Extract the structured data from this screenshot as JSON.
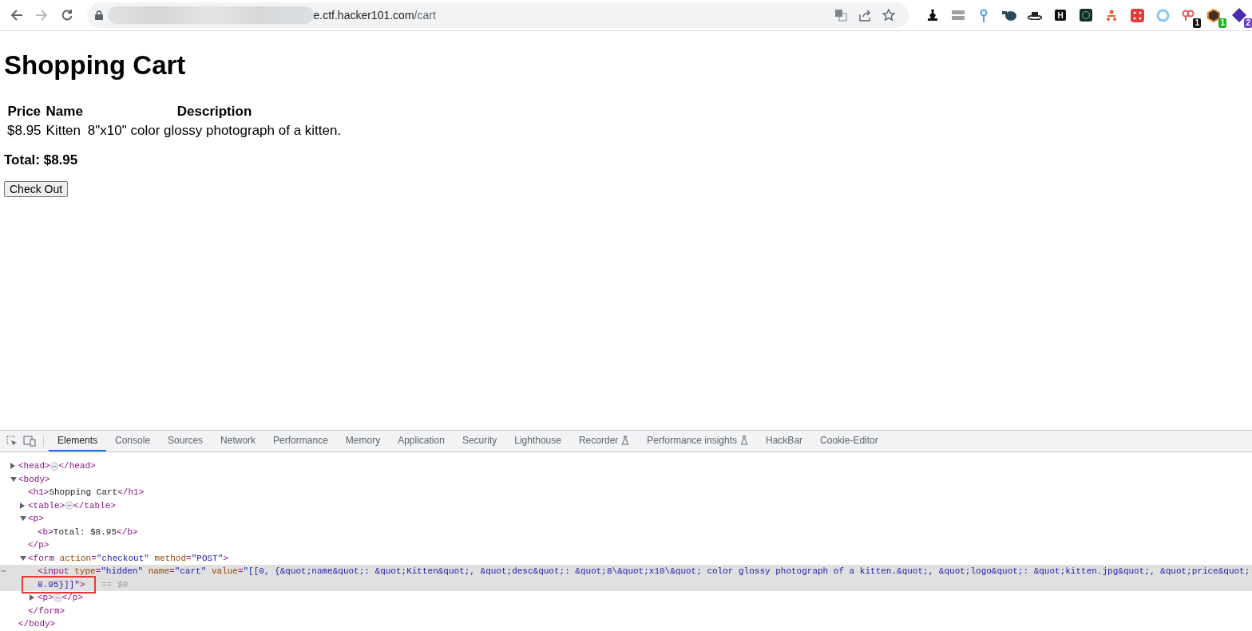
{
  "browser": {
    "back_enabled": true,
    "forward_enabled": false,
    "url_host": "e.ctf.hacker101.com",
    "url_path": "/cart",
    "extensions": [
      {
        "kind": "chess",
        "color": "#111111"
      },
      {
        "kind": "bars",
        "color": "#a0a0a0"
      },
      {
        "kind": "pin",
        "color": "#4a9ff5"
      },
      {
        "kind": "blob",
        "color": "#2c4a5a"
      },
      {
        "kind": "hat",
        "color": "#222222"
      },
      {
        "kind": "tile",
        "color": "#111111",
        "glyph": "H"
      },
      {
        "kind": "ringtile",
        "color": "#1e2a2a"
      },
      {
        "kind": "network",
        "color": "#e4602f"
      },
      {
        "kind": "dice",
        "color": "#e53935"
      },
      {
        "kind": "ring",
        "color": "#8cc4f0"
      },
      {
        "kind": "keys",
        "color": "#e05a5a",
        "badge": {
          "text": "1",
          "color": "#111111"
        }
      },
      {
        "kind": "hex",
        "color": "#f07d1a",
        "badge": {
          "text": "1",
          "color": "#1fb31f"
        }
      },
      {
        "kind": "diamond",
        "color": "#4b2bb0",
        "badge": {
          "text": "2",
          "color": "#6a3fd0"
        }
      }
    ]
  },
  "page": {
    "title": "Shopping Cart",
    "table": {
      "columns": [
        "Price",
        "Name",
        "Description"
      ],
      "rows": [
        [
          "$8.95",
          "Kitten",
          "8\"x10\" color glossy photograph of a kitten."
        ]
      ]
    },
    "total": "Total: $8.95",
    "button": "Check Out"
  },
  "devtools": {
    "tabs": [
      {
        "label": "Elements",
        "selected": true
      },
      {
        "label": "Console",
        "selected": false
      },
      {
        "label": "Sources",
        "selected": false
      },
      {
        "label": "Network",
        "selected": false
      },
      {
        "label": "Performance",
        "selected": false
      },
      {
        "label": "Memory",
        "selected": false
      },
      {
        "label": "Application",
        "selected": false
      },
      {
        "label": "Security",
        "selected": false
      },
      {
        "label": "Lighthouse",
        "selected": false
      },
      {
        "label": "Recorder",
        "selected": false,
        "experimental": true
      },
      {
        "label": "Performance insights",
        "selected": false,
        "experimental": true
      },
      {
        "label": "HackBar",
        "selected": false
      },
      {
        "label": "Cookie-Editor",
        "selected": false
      }
    ],
    "dom_tree": [
      {
        "selected": false,
        "expanded": false,
        "lines": [
          [
            {
              "kind": "tag",
              "text": "<head>"
            },
            {
              "kind": "more",
              "text": "⋯"
            },
            {
              "kind": "tag",
              "text": "</head>"
            }
          ]
        ]
      },
      {
        "selected": false,
        "expanded": true,
        "lines": [
          [
            {
              "kind": "tag",
              "text": "<body>"
            }
          ]
        ],
        "closing": [
          {
            "kind": "tag",
            "text": "</body>"
          }
        ],
        "children": [
          {
            "selected": false,
            "lines": [
              [
                {
                  "kind": "tag",
                  "text": "<h1>"
                },
                {
                  "kind": "text",
                  "text": "Shopping Cart"
                },
                {
                  "kind": "tag",
                  "text": "</h1>"
                }
              ]
            ]
          },
          {
            "selected": false,
            "expanded": false,
            "lines": [
              [
                {
                  "kind": "tag",
                  "text": "<table>"
                },
                {
                  "kind": "more",
                  "text": "⋯"
                },
                {
                  "kind": "tag",
                  "text": "</table>"
                }
              ]
            ]
          },
          {
            "selected": false,
            "expanded": true,
            "lines": [
              [
                {
                  "kind": "tag",
                  "text": "<p>"
                }
              ]
            ],
            "closing": [
              {
                "kind": "tag",
                "text": "</p>"
              }
            ],
            "children": [
              {
                "selected": false,
                "lines": [
                  [
                    {
                      "kind": "tag",
                      "text": "<b>"
                    },
                    {
                      "kind": "text",
                      "text": "Total: $8.95"
                    },
                    {
                      "kind": "tag",
                      "text": "</b>"
                    }
                  ]
                ]
              }
            ]
          },
          {
            "selected": false,
            "expanded": true,
            "lines": [
              [
                {
                  "kind": "tag",
                  "text": "<form"
                },
                {
                  "kind": "attr",
                  "text": " action"
                },
                {
                  "kind": "tag",
                  "text": "="
                },
                {
                  "kind": "value",
                  "text": "\"checkout\""
                },
                {
                  "kind": "attr",
                  "text": " method"
                },
                {
                  "kind": "tag",
                  "text": "="
                },
                {
                  "kind": "value",
                  "text": "\"POST\""
                },
                {
                  "kind": "tag",
                  "text": ">"
                }
              ]
            ],
            "closing": [
              {
                "kind": "tag",
                "text": "</form>"
              }
            ],
            "children": [
              {
                "selected": true,
                "marker": "⋯",
                "lines": [
                  [
                    {
                      "kind": "tag",
                      "text": "<input"
                    },
                    {
                      "kind": "attr",
                      "text": " type"
                    },
                    {
                      "kind": "tag",
                      "text": "="
                    },
                    {
                      "kind": "value",
                      "text": "\"hidden\""
                    },
                    {
                      "kind": "attr",
                      "text": " name"
                    },
                    {
                      "kind": "tag",
                      "text": "="
                    },
                    {
                      "kind": "value",
                      "text": "\"cart\""
                    },
                    {
                      "kind": "attr",
                      "text": " value"
                    },
                    {
                      "kind": "tag",
                      "text": "="
                    },
                    {
                      "kind": "value",
                      "text": "\"[[0, {&quot;name&quot;: &quot;Kitten&quot;, &quot;desc&quot;: &quot;8\\&quot;x10\\&quot; color glossy photograph of a kitten.&quot;, &quot;logo&quot;: &quot;kitten.jpg&quot;, &quot;price&quot;:"
                    }
                  ],
                  [
                    {
                      "kind": "value",
                      "text": "8.95}]]\"",
                      "boxed": true
                    },
                    {
                      "kind": "tag",
                      "text": ">",
                      "boxed": true
                    },
                    {
                      "kind": "ref",
                      "text": " == $0"
                    }
                  ]
                ]
              },
              {
                "selected": false,
                "expanded": false,
                "lines": [
                  [
                    {
                      "kind": "tag",
                      "text": "<p>"
                    },
                    {
                      "kind": "more",
                      "text": "⋯"
                    },
                    {
                      "kind": "tag",
                      "text": "</p>"
                    }
                  ]
                ]
              }
            ]
          }
        ]
      }
    ]
  }
}
